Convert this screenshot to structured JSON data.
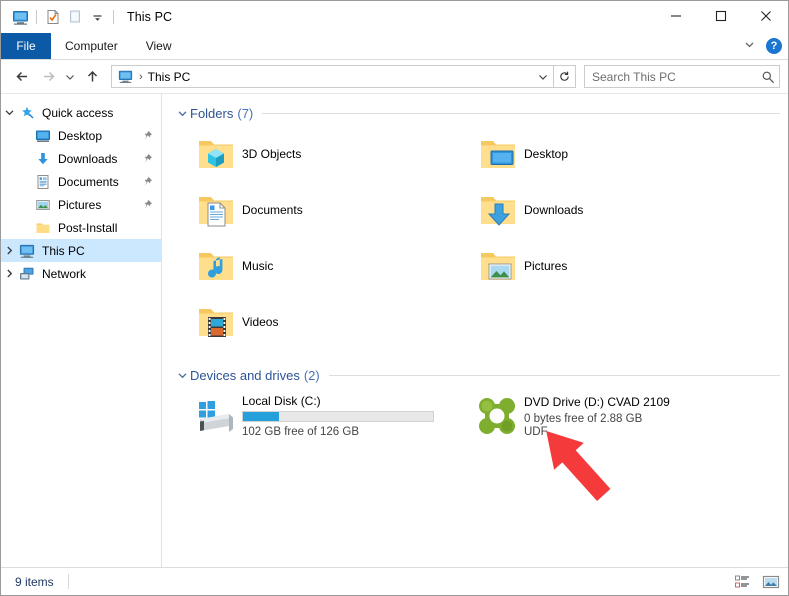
{
  "window": {
    "title": "This PC",
    "quick_access_toolbar": [
      "this-pc-icon",
      "properties-icon",
      "new-folder-icon",
      "customize-chevron-icon"
    ],
    "controls": {
      "minimize": "—",
      "maximize": "□",
      "close": "✕"
    }
  },
  "ribbon": {
    "tabs": [
      {
        "label": "File",
        "active": true
      },
      {
        "label": "Computer",
        "active": false
      },
      {
        "label": "View",
        "active": false
      }
    ],
    "collapse_label": "⌄",
    "help_label": "?"
  },
  "addressbar": {
    "back_label": "←",
    "forward_label": "→",
    "recent_label": "⌄",
    "up_label": "↑",
    "breadcrumb": {
      "icon": "this-pc-icon",
      "separator": "›",
      "text": "This PC"
    },
    "dropdown_label": "⌄",
    "refresh_label": "↻"
  },
  "search": {
    "placeholder": "Search This PC",
    "value": "",
    "icon": "search-icon"
  },
  "sidebar": {
    "items": [
      {
        "label": "Quick access",
        "icon": "star-pin-icon",
        "chevron": "⌄",
        "expanded": true,
        "level": 1,
        "pinned": false,
        "selected": false
      },
      {
        "label": "Desktop",
        "icon": "desktop-icon",
        "chevron": "",
        "level": 2,
        "pinned": true,
        "selected": false
      },
      {
        "label": "Downloads",
        "icon": "downloads-icon",
        "chevron": "",
        "level": 2,
        "pinned": true,
        "selected": false
      },
      {
        "label": "Documents",
        "icon": "documents-icon",
        "chevron": "",
        "level": 2,
        "pinned": true,
        "selected": false
      },
      {
        "label": "Pictures",
        "icon": "pictures-icon",
        "chevron": "",
        "level": 2,
        "pinned": true,
        "selected": false
      },
      {
        "label": "Post-Install",
        "icon": "folder-icon",
        "chevron": "",
        "level": 2,
        "pinned": false,
        "selected": false
      },
      {
        "label": "This PC",
        "icon": "this-pc-icon",
        "chevron": "›",
        "level": 1,
        "pinned": false,
        "selected": true
      },
      {
        "label": "Network",
        "icon": "network-icon",
        "chevron": "›",
        "level": 1,
        "pinned": false,
        "selected": false
      }
    ]
  },
  "content": {
    "groups": [
      {
        "title": "Folders",
        "count": "(7)",
        "chevron": "⌄",
        "items": [
          {
            "name": "3D Objects",
            "icon": "folder-3d-objects-icon"
          },
          {
            "name": "Desktop",
            "icon": "folder-desktop-icon"
          },
          {
            "name": "Documents",
            "icon": "folder-documents-icon"
          },
          {
            "name": "Downloads",
            "icon": "folder-downloads-icon"
          },
          {
            "name": "Music",
            "icon": "folder-music-icon"
          },
          {
            "name": "Pictures",
            "icon": "folder-pictures-icon"
          },
          {
            "name": "Videos",
            "icon": "folder-videos-icon"
          }
        ]
      },
      {
        "title": "Devices and drives",
        "count": "(2)",
        "chevron": "⌄",
        "items": [
          {
            "name": "Local Disk (C:)",
            "icon": "hard-drive-icon",
            "capacity_text": "102 GB free of 126 GB",
            "used_percent": 19,
            "filesystem": ""
          },
          {
            "name": "DVD Drive (D:) CVAD 2109",
            "icon": "dvd-drive-icon",
            "capacity_text": "0 bytes free of 2.88 GB",
            "used_percent": null,
            "filesystem": "UDF"
          }
        ]
      }
    ]
  },
  "statusbar": {
    "item_count": "9 items",
    "view_buttons": [
      "details-view-icon",
      "large-icons-view-icon"
    ]
  },
  "annotation": {
    "type": "red-arrow",
    "color": "#f43a3a",
    "points_to": "DVD Drive (D:) CVAD 2109"
  },
  "colors": {
    "accent": "#0c5aa6",
    "selection": "#cce8ff",
    "group_header": "#2c5495",
    "progress": "#26a0da",
    "annotation": "#f43a3a"
  }
}
